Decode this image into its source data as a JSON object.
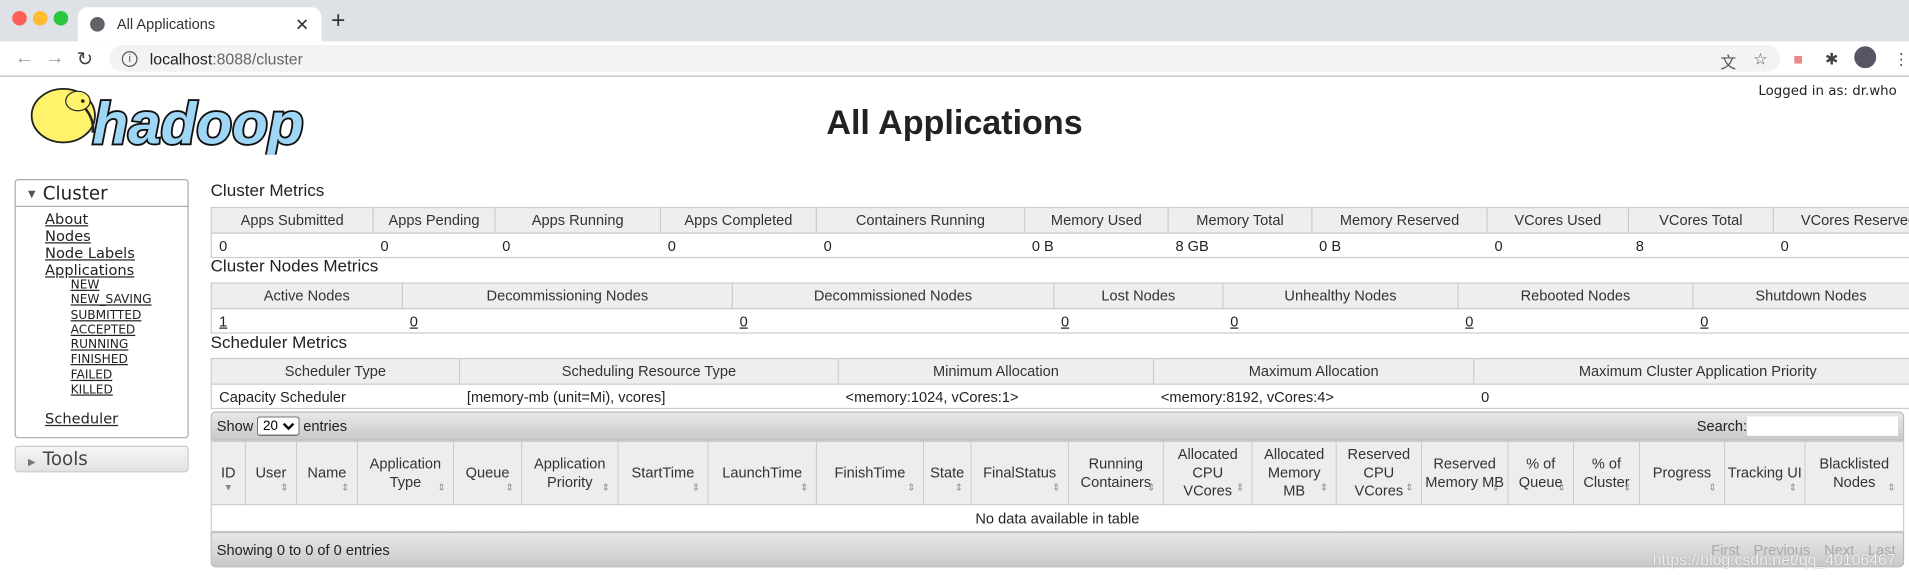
{
  "browser": {
    "tab_title": "All Applications",
    "url_host": "localhost",
    "url_path": ":8088/cluster",
    "colors": {
      "close": "#fe5f57",
      "min": "#febc2e",
      "max": "#28c840"
    }
  },
  "header": {
    "logo_text": "hadoop",
    "title": "All Applications",
    "logged_in": "Logged in as: dr.who"
  },
  "sidebar": {
    "cluster_label": "Cluster",
    "links": [
      "About",
      "Nodes",
      "Node Labels",
      "Applications"
    ],
    "app_states": [
      "NEW",
      "NEW_SAVING",
      "SUBMITTED",
      "ACCEPTED",
      "RUNNING",
      "FINISHED",
      "FAILED",
      "KILLED"
    ],
    "scheduler": "Scheduler",
    "tools_label": "Tools"
  },
  "cluster_metrics": {
    "title": "Cluster Metrics",
    "headers": [
      "Apps Submitted",
      "Apps Pending",
      "Apps Running",
      "Apps Completed",
      "Containers Running",
      "Memory Used",
      "Memory Total",
      "Memory Reserved",
      "VCores Used",
      "VCores Total",
      "VCores Reserved"
    ],
    "values": [
      "0",
      "0",
      "0",
      "0",
      "0",
      "0 B",
      "8 GB",
      "0 B",
      "0",
      "8",
      "0"
    ]
  },
  "nodes_metrics": {
    "title": "Cluster Nodes Metrics",
    "headers": [
      "Active Nodes",
      "Decommissioning Nodes",
      "Decommissioned Nodes",
      "Lost Nodes",
      "Unhealthy Nodes",
      "Rebooted Nodes",
      "Shutdown Nodes"
    ],
    "values": [
      "1",
      "0",
      "0",
      "0",
      "0",
      "0",
      "0"
    ]
  },
  "scheduler_metrics": {
    "title": "Scheduler Metrics",
    "headers": [
      "Scheduler Type",
      "Scheduling Resource Type",
      "Minimum Allocation",
      "Maximum Allocation",
      "Maximum Cluster Application Priority"
    ],
    "values": [
      "Capacity Scheduler",
      "[memory-mb (unit=Mi), vcores]",
      "<memory:1024, vCores:1>",
      "<memory:8192, vCores:4>",
      "0"
    ]
  },
  "apps": {
    "show": "Show",
    "entries_value": "20",
    "entries": "entries",
    "search": "Search:",
    "search_value": "",
    "headers": [
      "ID",
      "User",
      "Name",
      "Application Type",
      "Queue",
      "Application Priority",
      "StartTime",
      "LaunchTime",
      "FinishTime",
      "State",
      "FinalStatus",
      "Running Containers",
      "Allocated CPU VCores",
      "Allocated Memory MB",
      "Reserved CPU VCores",
      "Reserved Memory MB",
      "% of Queue",
      "% of Cluster",
      "Progress",
      "Tracking UI",
      "Blacklisted Nodes"
    ],
    "empty": "No data available in table",
    "info": "Showing 0 to 0 of 0 entries",
    "pager": [
      "First",
      "Previous",
      "Next",
      "Last"
    ]
  },
  "watermark": "https://blog.csdn.net/qq_40106467"
}
